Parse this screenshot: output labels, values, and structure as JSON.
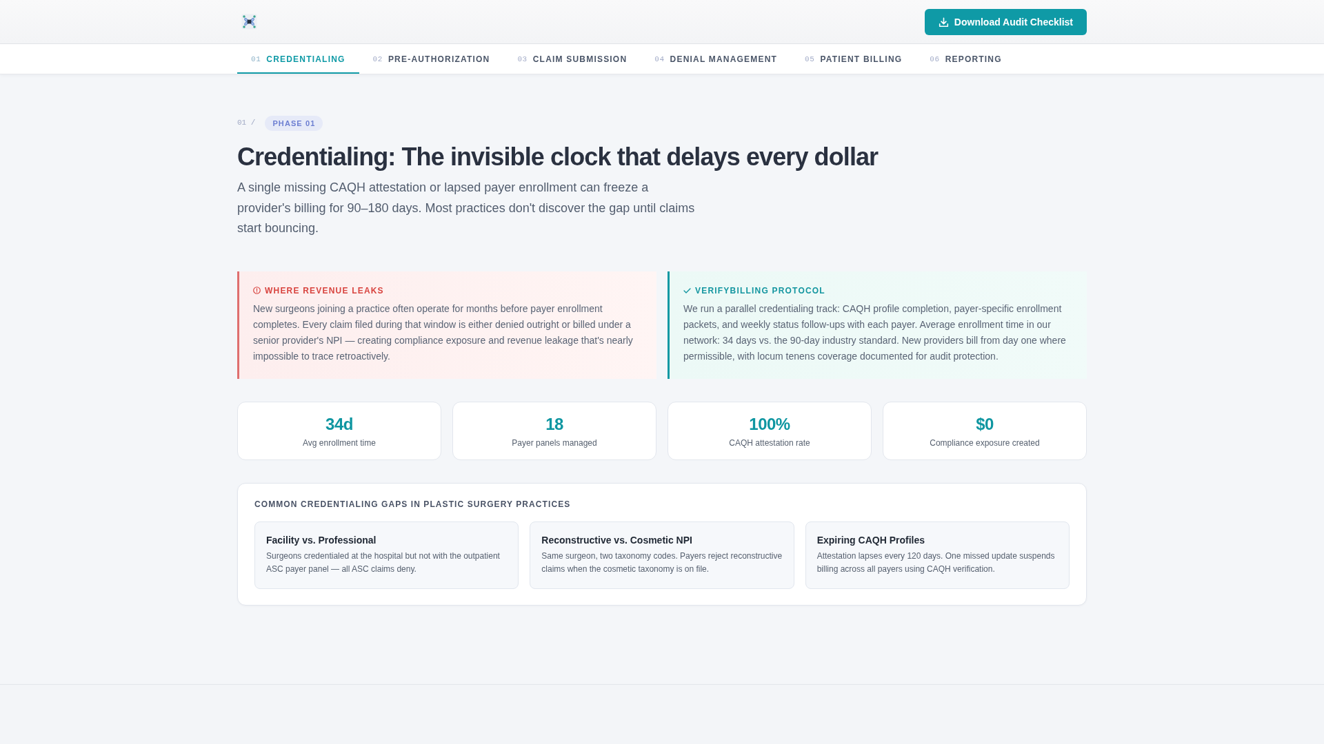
{
  "header": {
    "download_button": "Download Audit Checklist"
  },
  "tabs": [
    {
      "number": "01",
      "label": "CREDENTIALING",
      "selected": true
    },
    {
      "number": "02",
      "label": "PRE-AUTHORIZATION",
      "selected": false
    },
    {
      "number": "03",
      "label": "CLAIM SUBMISSION",
      "selected": false
    },
    {
      "number": "04",
      "label": "DENIAL MANAGEMENT",
      "selected": false
    },
    {
      "number": "05",
      "label": "PATIENT BILLING",
      "selected": false
    },
    {
      "number": "06",
      "label": "REPORTING",
      "selected": false
    }
  ],
  "breadcrumb": {
    "number": "01 /",
    "phase": "PHASE 01"
  },
  "title": "Credentialing: The invisible clock that delays every dollar",
  "intro": "A single missing CAQH attestation or lapsed payer enrollment can freeze a provider's billing for 90–180 days. Most practices don't discover the gap until claims start bouncing.",
  "callouts": [
    {
      "kind": "warning",
      "title": "WHERE REVENUE LEAKS",
      "body": "New surgeons joining a practice often operate for months before payer enrollment completes. Every claim filed during that window is either denied outright or billed under a senior provider's NPI — creating compliance exposure and revenue leakage that's nearly impossible to trace retroactively."
    },
    {
      "kind": "success",
      "title": "VERIFYBILLING PROTOCOL",
      "body": "We run a parallel credentialing track: CAQH profile completion, payer-specific enrollment packets, and weekly status follow-ups with each payer. Average enrollment time in our network: 34 days vs. the 90-day industry standard. New providers bill from day one where permissible, with locum tenens coverage documented for audit protection."
    }
  ],
  "stats": [
    {
      "value": "34d",
      "label": "Avg enrollment time"
    },
    {
      "value": "18",
      "label": "Payer panels managed"
    },
    {
      "value": "100%",
      "label": "CAQH attestation rate"
    },
    {
      "value": "$0",
      "label": "Compliance exposure created"
    }
  ],
  "gaps": {
    "title": "COMMON CREDENTIALING GAPS IN PLASTIC SURGERY PRACTICES",
    "items": [
      {
        "title": "Facility vs. Professional",
        "description": "Surgeons credentialed at the hospital but not with the outpatient ASC payer panel — all ASC claims deny."
      },
      {
        "title": "Reconstructive vs. Cosmetic NPI",
        "description": "Same surgeon, two taxonomy codes. Payers reject reconstructive claims when the cosmetic taxonomy is on file."
      },
      {
        "title": "Expiring CAQH Profiles",
        "description": "Attestation lapses every 120 days. One missed update suspends billing across all payers using CAQH verification."
      }
    ]
  }
}
